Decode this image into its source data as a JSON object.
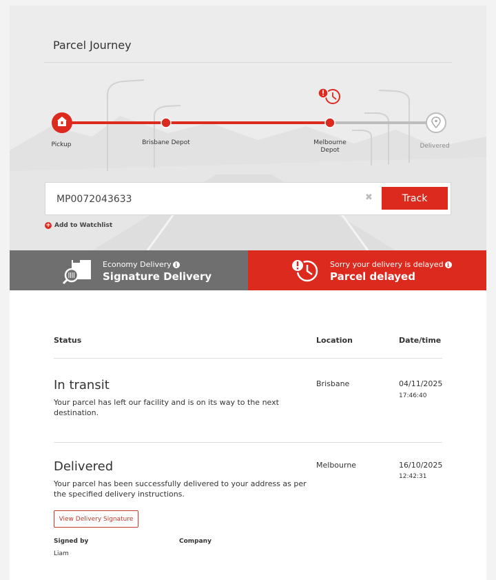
{
  "hero": {
    "title": "Parcel Journey",
    "stages": [
      {
        "label": "Pickup",
        "status": "complete"
      },
      {
        "label": "Brisbane Depot",
        "status": "complete"
      },
      {
        "label": "Melbourne Depot",
        "status": "current-delayed"
      },
      {
        "label": "Delivered",
        "status": "pending"
      }
    ]
  },
  "tracking": {
    "number": "MP0072043633",
    "button_label": "Track",
    "clear_symbol": "✖",
    "watchlist_label": "Add to Watchlist"
  },
  "service_banner": {
    "sub": "Economy Delivery",
    "main": "Signature Delivery"
  },
  "status_banner": {
    "sub": "Sorry your delivery is delayed",
    "main": "Parcel delayed"
  },
  "table": {
    "headers": {
      "status": "Status",
      "location": "Location",
      "datetime": "Date/time"
    },
    "events": [
      {
        "title": "In transit",
        "description": "Your parcel has left our facility and is on its way to the next destination.",
        "location": "Brisbane",
        "date": "04/11/2025",
        "time": "17:46:40"
      },
      {
        "title": "Delivered",
        "description": "Your parcel has been successfully delivered to your address as per the specified delivery instructions.",
        "location": "Melbourne",
        "date": "16/10/2025",
        "time": "12:42:31",
        "signature_button": "View Delivery Signature",
        "signed_by_label": "Signed by",
        "signed_by_value": "Liam",
        "company_label": "Company"
      }
    ]
  },
  "colors": {
    "brand_red": "#dc2a1f",
    "banner_gray": "#6f6f6f",
    "progress_gray": "#bdbdbd"
  }
}
